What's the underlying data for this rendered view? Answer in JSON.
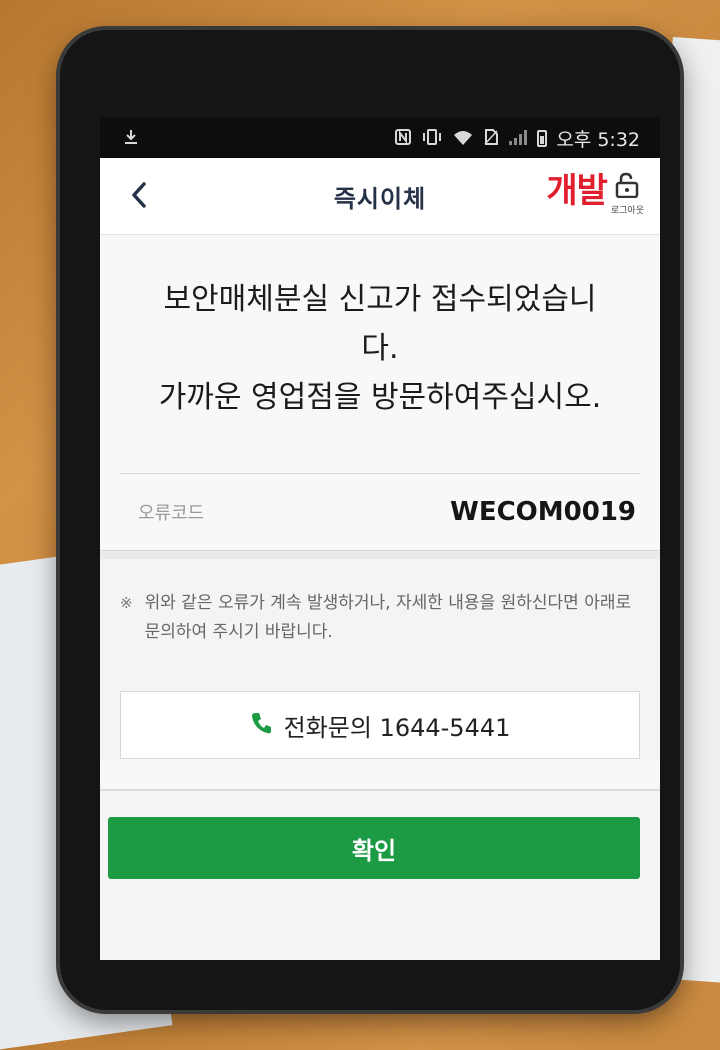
{
  "status_bar": {
    "time": "오후 5:32",
    "icons": [
      "download-icon",
      "nfc-icon",
      "vibrate-icon",
      "wifi-icon",
      "no-sim-icon",
      "signal-icon",
      "battery-icon"
    ]
  },
  "header": {
    "title": "즉시이체",
    "brand": "개발",
    "logout_label": "로그아웃",
    "brand_color": "#e0202e"
  },
  "message": {
    "text": "보안매체분실 신고가 접수되었습니\n다.\n가까운 영업점을 방문하여주십시오."
  },
  "error": {
    "label": "오류코드",
    "code": "WECOM0019"
  },
  "note": {
    "mark": "※",
    "text": "위와 같은 오류가 계속 발생하거나, 자세한 내용을 원하신다면 아래로 문의하여 주시기 바랍니다."
  },
  "phone_button": {
    "label": "전화문의 1644-5441",
    "icon": "phone-icon",
    "icon_color": "#1d9a44"
  },
  "confirm_button": {
    "label": "확인",
    "color": "#1d9a44"
  }
}
